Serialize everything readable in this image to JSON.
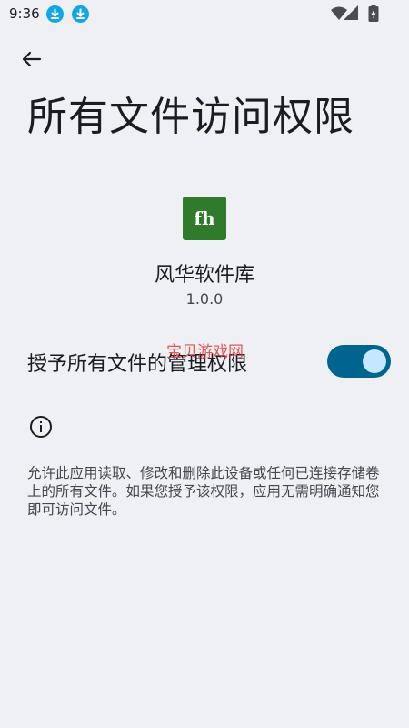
{
  "status_bar": {
    "time": "9:36"
  },
  "header": {
    "back_icon": "arrow-back-icon",
    "title": "所有文件访问权限"
  },
  "app": {
    "icon_text": "fh",
    "icon_color": "#2f7a2b",
    "name": "风华软件库",
    "version": "1.0.0"
  },
  "permission": {
    "label": "授予所有文件的管理权限",
    "enabled": true,
    "toggle_color": "#00658e"
  },
  "watermark": "宝贝游戏网",
  "info": {
    "icon": "info-icon",
    "description": "允许此应用读取、修改和删除此设备或任何已连接存储卷上的所有文件。如果您授予该权限，应用无需明确通知您即可访问文件。"
  }
}
